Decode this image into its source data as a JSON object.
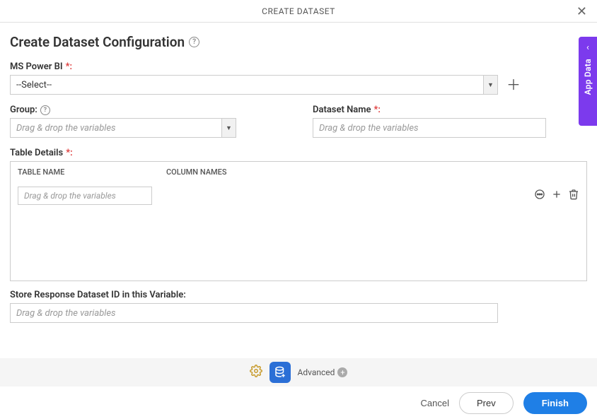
{
  "titlebar": {
    "title": "CREATE DATASET"
  },
  "heading": "Create Dataset Configuration",
  "fields": {
    "powerbi": {
      "label": "MS Power BI",
      "value": "--Select--"
    },
    "group": {
      "label": "Group:",
      "placeholder": "Drag & drop the variables"
    },
    "datasetName": {
      "label": "Dataset Name",
      "placeholder": "Drag & drop the variables"
    },
    "tableDetails": {
      "label": "Table Details",
      "headers": {
        "name": "TABLE NAME",
        "cols": "COLUMN NAMES"
      },
      "rowPlaceholder": "Drag & drop the variables"
    },
    "storeVar": {
      "label": "Store Response Dataset ID in this Variable:",
      "placeholder": "Drag & drop the variables"
    }
  },
  "bottomStrip": {
    "advanced": "Advanced"
  },
  "footer": {
    "cancel": "Cancel",
    "prev": "Prev",
    "finish": "Finish"
  },
  "sideTab": {
    "label": "App Data"
  }
}
